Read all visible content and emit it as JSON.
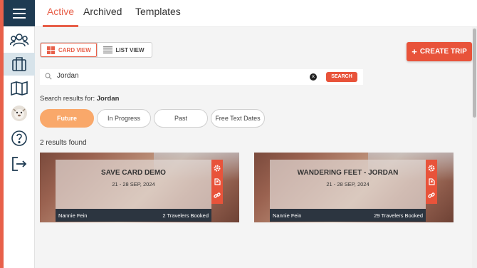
{
  "tabs": [
    {
      "label": "Active"
    },
    {
      "label": "Archived"
    },
    {
      "label": "Templates"
    }
  ],
  "sidebar": {
    "items": [
      {
        "icon": "users-icon"
      },
      {
        "icon": "luggage-icon"
      },
      {
        "icon": "map-icon"
      },
      {
        "icon": "avatar"
      },
      {
        "icon": "help-icon"
      },
      {
        "icon": "logout-icon"
      }
    ]
  },
  "view_toggle": {
    "card_label": "CARD VIEW",
    "list_label": "LIST VIEW",
    "selected": "CARD VIEW"
  },
  "create_trip": {
    "label": "CREATE TRIP",
    "icon": "+"
  },
  "search": {
    "value": "Jordan",
    "button_label": "SEARCH"
  },
  "results_for": {
    "prefix": "Search results for:",
    "term": "Jordan"
  },
  "filters": [
    {
      "label": "Future",
      "active": true
    },
    {
      "label": "In Progress",
      "active": false
    },
    {
      "label": "Past",
      "active": false
    },
    {
      "label": "Free Text Dates",
      "active": false
    }
  ],
  "results_count": "2 results found",
  "cards": [
    {
      "title": "SAVE CARD DEMO",
      "dates": "21 - 28 SEP, 2024",
      "owner": "Nannie Fein",
      "travelers": "2 Travelers Booked"
    },
    {
      "title": "WANDERING FEET - JORDAN",
      "dates": "21 - 28 SEP, 2024",
      "owner": "Nannie Fein",
      "travelers": "29 Travelers Booked"
    }
  ],
  "colors": {
    "accent": "#e8604a",
    "navy": "#1e3b52",
    "future_pill": "#f9a86a"
  }
}
